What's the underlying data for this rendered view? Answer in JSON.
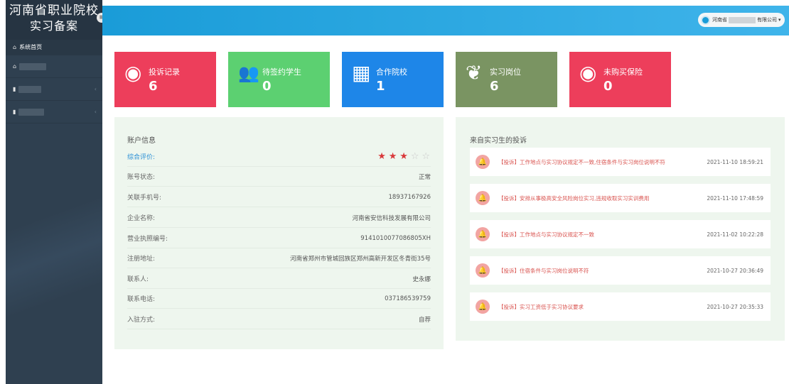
{
  "sidebar": {
    "brand_line1": "河南省职业院校",
    "brand_line2": "实习备案",
    "collapse_glyph": "≡",
    "items": [
      {
        "label": "系统首页",
        "icon": "home-icon",
        "glyph": "⌂"
      },
      {
        "label": "",
        "icon": "home-icon",
        "glyph": "⌂"
      },
      {
        "label": "",
        "icon": "bookmark-icon",
        "glyph": "▮"
      },
      {
        "label": "",
        "icon": "bookmark-icon",
        "glyph": "▮"
      }
    ],
    "arrow": "‹"
  },
  "header": {
    "user_prefix": "河南省",
    "user_suffix": "有限公司",
    "dropdown_glyph": "▾"
  },
  "stats": [
    {
      "label": "投诉记录",
      "value": "6",
      "color": "#ed3e5b",
      "icon": "eye-icon",
      "glyph": "◉"
    },
    {
      "label": "待签约学生",
      "value": "0",
      "color": "#5cd071",
      "icon": "users-icon",
      "glyph": "👥"
    },
    {
      "label": "合作院校",
      "value": "1",
      "color": "#1e86e8",
      "icon": "building-icon",
      "glyph": "▦"
    },
    {
      "label": "实习岗位",
      "value": "6",
      "color": "#7a9462",
      "icon": "leaf-icon",
      "glyph": "❦"
    },
    {
      "label": "未购买保险",
      "value": "0",
      "color": "#ed3e5b",
      "icon": "eye-icon",
      "glyph": "◉"
    }
  ],
  "account": {
    "title": "账户信息",
    "rating_label": "综合评价:",
    "rating": 3,
    "rating_max": 5,
    "rows": [
      {
        "label": "账号状态:",
        "value": "正常"
      },
      {
        "label": "关联手机号:",
        "value": "18937167926"
      },
      {
        "label": "企业名称:",
        "value": "河南省安信科技发展有限公司"
      },
      {
        "label": "营业执照编号:",
        "value": "9141010077086805XH"
      },
      {
        "label": "注册地址:",
        "value": "河南省郑州市管城回族区郑州高新开发区冬青街35号"
      },
      {
        "label": "联系人:",
        "value": "史永娜"
      },
      {
        "label": "联系电话:",
        "value": "037186539759"
      },
      {
        "label": "入驻方式:",
        "value": "自荐"
      }
    ]
  },
  "complaints": {
    "title": "来自实习生的投诉",
    "items": [
      {
        "text": "【投诉】工作地点与实习协议规定不一致,住宿条件与实习岗位说明不符",
        "time": "2021-11-10 18:59:21"
      },
      {
        "text": "【投诉】安排从事极高安全风险岗位实习,违规收取实习实训费用",
        "time": "2021-11-10 17:48:59"
      },
      {
        "text": "【投诉】工作地点与实习协议规定不一致",
        "time": "2021-11-02 10:22:28"
      },
      {
        "text": "【投诉】住宿条件与实习岗位说明不符",
        "time": "2021-10-27 20:36:49"
      },
      {
        "text": "【投诉】实习工资低于实习协议要求",
        "time": "2021-10-27 20:35:33"
      }
    ]
  }
}
